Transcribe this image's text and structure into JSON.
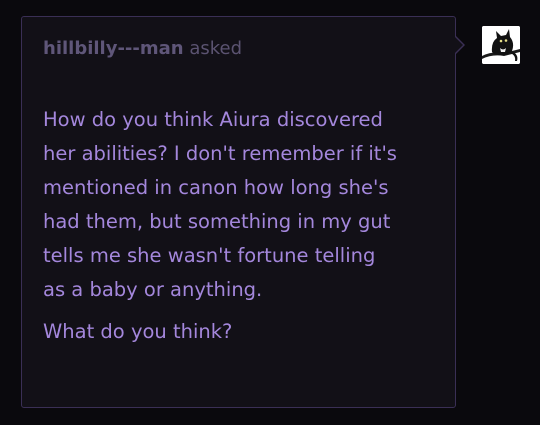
{
  "ask": {
    "asker_name": "hillbilly---man",
    "asked_label": "asked",
    "paragraphs": [
      "How do you think Aiura discovered\nher abilities? I don't remember if it's\nmentioned in canon how long she's\nhad them, but something in my gut\ntells me she wasn't fortune telling\nas a baby or anything.",
      "What do you think?"
    ]
  },
  "colors": {
    "background": "#0a090d",
    "bubble_background": "#121017",
    "bubble_border": "#3a2f55",
    "asker_text": "#5f5679",
    "body_text": "#a487dc"
  },
  "icons": {
    "avatar": "black-cat-avatar"
  }
}
